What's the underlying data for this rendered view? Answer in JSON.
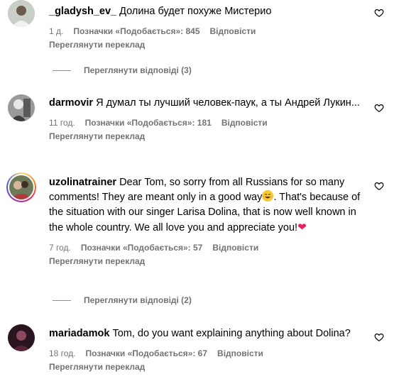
{
  "comments": [
    {
      "username": "_gladysh_ev_",
      "text": "Долина будет похуже Мистерио",
      "time": "1 д.",
      "likes": "Позначки «Подобається»: 845",
      "reply": "Відповісти",
      "translate": "Переглянути переклад",
      "replies": "Переглянути відповіді (3)"
    },
    {
      "username": "darmovir",
      "text": "Я думал ты лучший человек-паук, а ты Андрей Лукин...",
      "time": "11 год.",
      "likes": "Позначки «Подобається»: 181",
      "reply": "Відповісти",
      "translate": "Переглянути переклад"
    },
    {
      "username": "uzolinatrainer",
      "text_part1": "Dear Tom, so sorry from all Russians for so many comments! They are meant only in a good way",
      "text_part2": ". That's because of the situation with our singer Larisa Dolina, that is now well known in the whole country. We all love you and appreciate you!",
      "heart_emoji": "❤",
      "time": "7 год.",
      "likes": "Позначки «Подобається»: 57",
      "reply": "Відповісти",
      "translate": "Переглянути переклад",
      "replies": "Переглянути відповіді (2)"
    },
    {
      "username": "mariadamok",
      "text": "Tom, do you want explaining anything about Dolina?",
      "time": "18 год.",
      "likes": "Позначки «Подобається»: 67",
      "reply": "Відповісти",
      "translate": "Переглянути переклад"
    }
  ],
  "icons": {
    "like": "heart-outline-icon",
    "laugh_emoji": "face-with-tears-of-joy",
    "colors": {
      "muted": "#737373",
      "text": "#000000",
      "heart": "#e0245e"
    }
  }
}
